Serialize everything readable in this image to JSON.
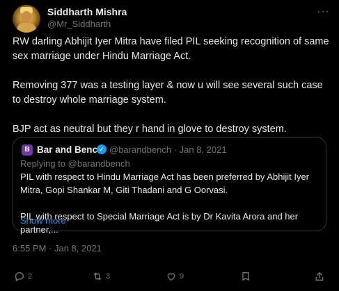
{
  "author": {
    "name": "Siddharth Mishra",
    "handle": "@Mr_Siddharth"
  },
  "tweet_text": "RW darling Abhijit Iyer Mitra have filed PIL seeking recognition of same sex marriage under Hindu Marriage Act.\n\nRemoving 377 was a testing layer & now u will see several such case to destroy whole marriage system.\n\nBJP act as neutral but they r hand in glove to destroy system.",
  "quoted": {
    "logo_text": "B",
    "name": "Bar and Bench",
    "meta": "@barandbench · Jan 8, 2021",
    "replying_to": "Replying to @barandbench",
    "text": "PIL with respect to Hindu Marriage Act has been preferred by Abhijit Iyer Mitra, Gopi Shankar M, Giti Thadani and G Oorvasi.\n\nPIL with respect to Special Marriage Act is by Dr Kavita Arora and her partner,...",
    "show_more": "Show more"
  },
  "timestamp": "6:55 PM · Jan 8, 2021",
  "actions": {
    "reply_count": "2",
    "retweet_count": "3",
    "like_count": "9"
  },
  "icons": {
    "more": "more-dots-icon",
    "verified": "verified-badge-icon",
    "reply": "reply-icon",
    "retweet": "retweet-icon",
    "like": "heart-icon",
    "bookmark": "bookmark-icon",
    "share": "share-icon"
  },
  "colors": {
    "background": "#000000",
    "text": "#e7e9ea",
    "muted": "#71767b",
    "accent": "#1d9bf0",
    "border": "#2f3336"
  }
}
